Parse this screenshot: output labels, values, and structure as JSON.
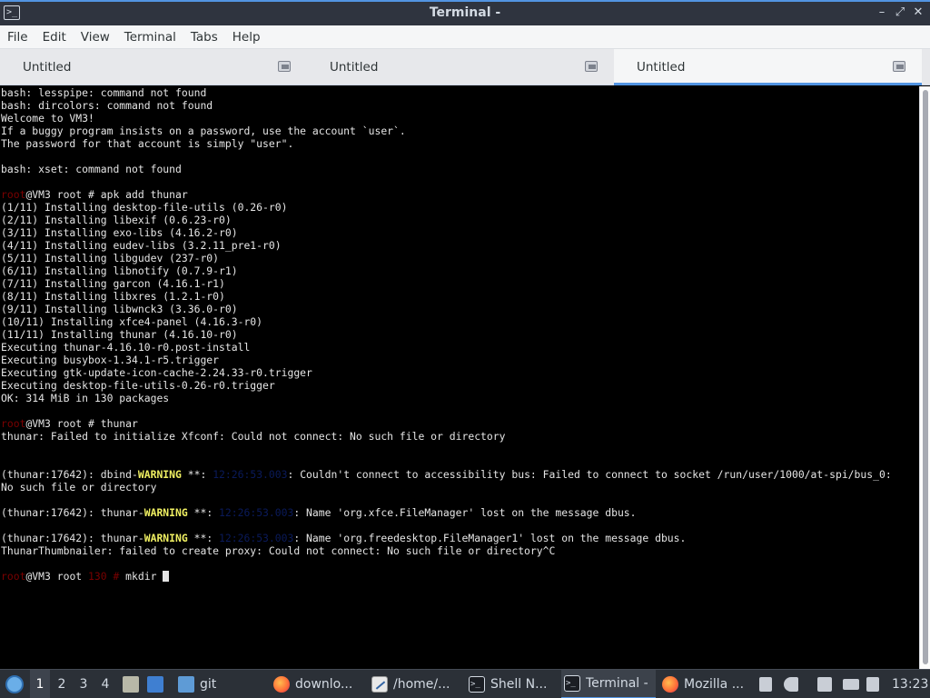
{
  "window": {
    "title": "Terminal -",
    "icon": "terminal-icon",
    "controls": {
      "minimize": "–",
      "maximize": "⤢",
      "close": "✕"
    }
  },
  "menubar": {
    "items": [
      "File",
      "Edit",
      "View",
      "Terminal",
      "Tabs",
      "Help"
    ]
  },
  "tabs": [
    {
      "label": "Untitled",
      "active": false
    },
    {
      "label": "Untitled",
      "active": false
    },
    {
      "label": "Untitled",
      "active": true
    }
  ],
  "terminal": {
    "lines": [
      [
        {
          "t": "bash: lesspipe: command not found"
        }
      ],
      [
        {
          "t": "bash: dircolors: command not found"
        }
      ],
      [
        {
          "t": "Welcome to VM3!"
        }
      ],
      [
        {
          "t": "If a buggy program insists on a password, use the account `user`."
        }
      ],
      [
        {
          "t": "The password for that account is simply \"user\"."
        }
      ],
      [],
      [
        {
          "t": "bash: xset: command not found"
        }
      ],
      [],
      [
        {
          "t": "root",
          "c": "r"
        },
        {
          "t": "@VM3 root # apk add thunar"
        }
      ],
      [
        {
          "t": "(1/11) Installing desktop-file-utils (0.26-r0)"
        }
      ],
      [
        {
          "t": "(2/11) Installing libexif (0.6.23-r0)"
        }
      ],
      [
        {
          "t": "(3/11) Installing exo-libs (4.16.2-r0)"
        }
      ],
      [
        {
          "t": "(4/11) Installing eudev-libs (3.2.11_pre1-r0)"
        }
      ],
      [
        {
          "t": "(5/11) Installing libgudev (237-r0)"
        }
      ],
      [
        {
          "t": "(6/11) Installing libnotify (0.7.9-r1)"
        }
      ],
      [
        {
          "t": "(7/11) Installing garcon (4.16.1-r1)"
        }
      ],
      [
        {
          "t": "(8/11) Installing libxres (1.2.1-r0)"
        }
      ],
      [
        {
          "t": "(9/11) Installing libwnck3 (3.36.0-r0)"
        }
      ],
      [
        {
          "t": "(10/11) Installing xfce4-panel (4.16.3-r0)"
        }
      ],
      [
        {
          "t": "(11/11) Installing thunar (4.16.10-r0)"
        }
      ],
      [
        {
          "t": "Executing thunar-4.16.10-r0.post-install"
        }
      ],
      [
        {
          "t": "Executing busybox-1.34.1-r5.trigger"
        }
      ],
      [
        {
          "t": "Executing gtk-update-icon-cache-2.24.33-r0.trigger"
        }
      ],
      [
        {
          "t": "Executing desktop-file-utils-0.26-r0.trigger"
        }
      ],
      [
        {
          "t": "OK: 314 MiB in 130 packages"
        }
      ],
      [],
      [
        {
          "t": "root",
          "c": "r"
        },
        {
          "t": "@VM3 root # thunar"
        }
      ],
      [
        {
          "t": "thunar: Failed to initialize Xfconf: Could not connect: No such file or directory"
        }
      ],
      [],
      [],
      [
        {
          "t": "(thunar:17642): dbind-"
        },
        {
          "t": "WARNING",
          "c": "y"
        },
        {
          "t": " **: "
        },
        {
          "t": "12:26:53.003",
          "c": "d"
        },
        {
          "t": ": Couldn't connect to accessibility bus: Failed to connect to socket /run/user/1000/at-spi/bus_0:"
        }
      ],
      [
        {
          "t": "No such file or directory"
        }
      ],
      [],
      [
        {
          "t": "(thunar:17642): thunar-"
        },
        {
          "t": "WARNING",
          "c": "y"
        },
        {
          "t": " **: "
        },
        {
          "t": "12:26:53.003",
          "c": "d"
        },
        {
          "t": ": Name 'org.xfce.FileManager' lost on the message dbus."
        }
      ],
      [],
      [
        {
          "t": "(thunar:17642): thunar-"
        },
        {
          "t": "WARNING",
          "c": "y"
        },
        {
          "t": " **: "
        },
        {
          "t": "12:26:53.003",
          "c": "d"
        },
        {
          "t": ": Name 'org.freedesktop.FileManager1' lost on the message dbus."
        }
      ],
      [
        {
          "t": "ThunarThumbnailer: failed to create proxy: Could not connect: No such file or directory^C"
        }
      ],
      [],
      [
        {
          "t": "root",
          "c": "r"
        },
        {
          "t": "@VM3 root "
        },
        {
          "t": "130",
          "c": "r"
        },
        {
          "t": " "
        },
        {
          "t": "#",
          "c": "r"
        },
        {
          "t": " mkdir "
        },
        {
          "cursor": true
        }
      ]
    ]
  },
  "panel": {
    "workspaces": [
      "1",
      "2",
      "3",
      "4"
    ],
    "launchers": [
      {
        "icon": "file-manager-icon"
      },
      {
        "icon": "desktop-icon"
      }
    ],
    "tasks": [
      {
        "label": "git",
        "icon": "folder-icon",
        "active": false
      },
      {
        "label": "downlo...",
        "icon": "firefox-icon",
        "active": false
      },
      {
        "label": "/home/...",
        "icon": "text-editor-icon",
        "active": false
      },
      {
        "label": "Shell N...",
        "icon": "terminal-icon",
        "active": false
      },
      {
        "label": "Terminal -",
        "icon": "terminal-icon",
        "active": true
      },
      {
        "label": "Mozilla ...",
        "icon": "firefox-icon",
        "active": false
      }
    ],
    "tray": [
      "separator-icon",
      "volume-icon",
      "clipboard-icon",
      "keyboard-icon",
      "network-icon"
    ],
    "clock": "13:23"
  }
}
